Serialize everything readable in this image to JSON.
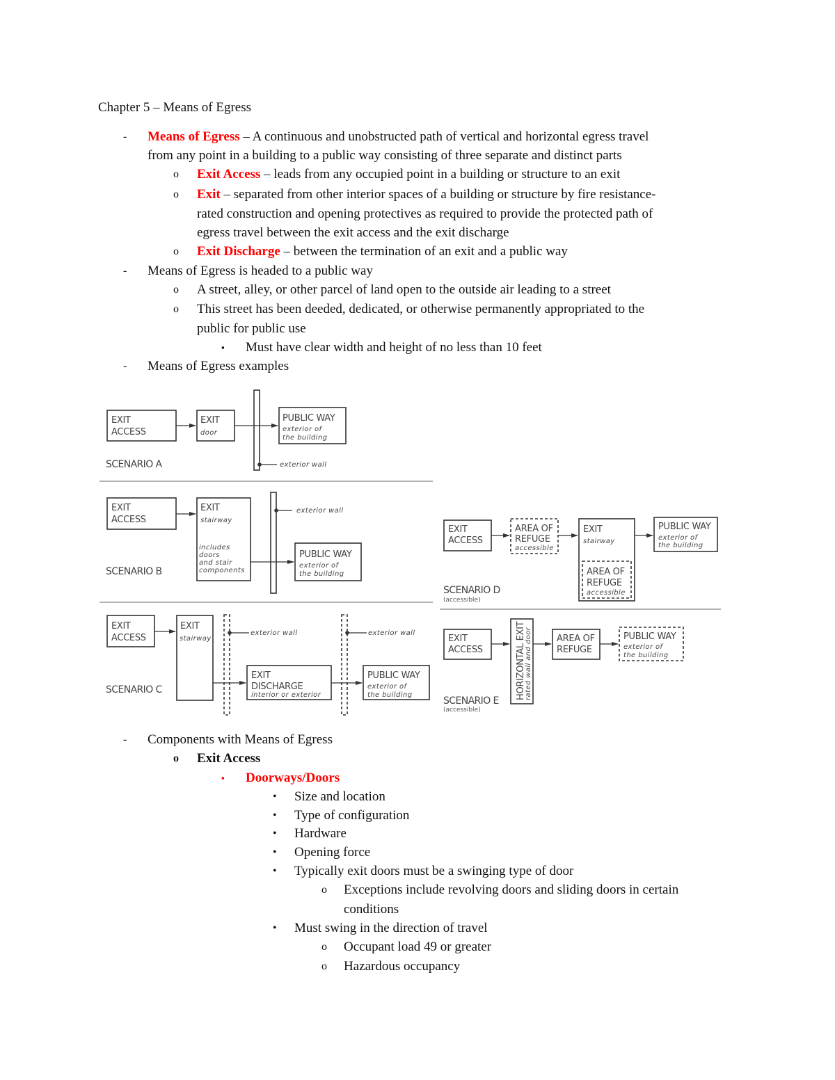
{
  "document": {
    "title": "Chapter 5 – Means of Egress",
    "markers": {
      "dash": "-",
      "circle": "o",
      "square": "▪",
      "bullet": "•"
    },
    "section1": {
      "term": "Means of Egress",
      "definition_line1": " – A continuous and unobstructed path of vertical and horizontal egress travel",
      "definition_line2": "from any point in a building to a public way consisting of three separate and distinct parts",
      "parts": [
        {
          "term": "Exit Access",
          "text": " – leads from any occupied point in a building or structure to an exit"
        },
        {
          "term": "Exit",
          "text": " – separated from other interior spaces of a building or structure by fire resistance-",
          "text_line2": "rated construction and opening protectives as required to provide the protected path of",
          "text_line3": "egress travel between the exit access and the exit discharge"
        },
        {
          "term": "Exit Discharge",
          "text": " – between the termination of an exit and a public way"
        }
      ]
    },
    "section2": {
      "heading": "Means of Egress is headed to a public way",
      "items": [
        "A street, alley, or other parcel of land open to the outside air leading to a street",
        "This street has been deeded, dedicated, or otherwise permanently appropriated to the",
        "public for public use"
      ],
      "sub_item": "Must have clear width and height of no less than 10 feet"
    },
    "section3": {
      "heading": "Means of Egress examples"
    },
    "section4": {
      "heading": "Components with Means of Egress",
      "subheading": "Exit Access",
      "category": "Doorways/Doors",
      "bullets": [
        "Size and location",
        "Type of configuration",
        "Hardware",
        "Opening force",
        "Typically  exit doors must be a swinging type of door",
        "Must swing in the direction of travel"
      ],
      "exceptions": [
        "Exceptions include revolving doors and sliding doors in certain",
        "conditions"
      ],
      "swing_conditions": [
        "Occupant load 49 or greater",
        "Hazardous occupancy"
      ]
    }
  },
  "diagram": {
    "exit": "EXIT",
    "access": "ACCESS",
    "public_way": "PUBLIC WAY",
    "exterior_of": "exterior of",
    "the_building": "the building",
    "exterior_wall": "exterior wall",
    "door": "door",
    "stairway": "stairway",
    "includes": [
      "includes",
      "doors",
      "and stair",
      "components"
    ],
    "discharge": "DISCHARGE",
    "interior_or_exterior": "interior or exterior",
    "area_of": "AREA OF",
    "refuge": "REFUGE",
    "accessible": "accessible",
    "horizontal_exit": "HORIZONTAL EXIT",
    "rated_wall_and_door": "rated wall and door",
    "scenarios": {
      "a": "SCENARIO A",
      "b": "SCENARIO B",
      "c": "SCENARIO C",
      "d": "SCENARIO D",
      "e": "SCENARIO E",
      "accessible_note": "(accessible)"
    }
  }
}
